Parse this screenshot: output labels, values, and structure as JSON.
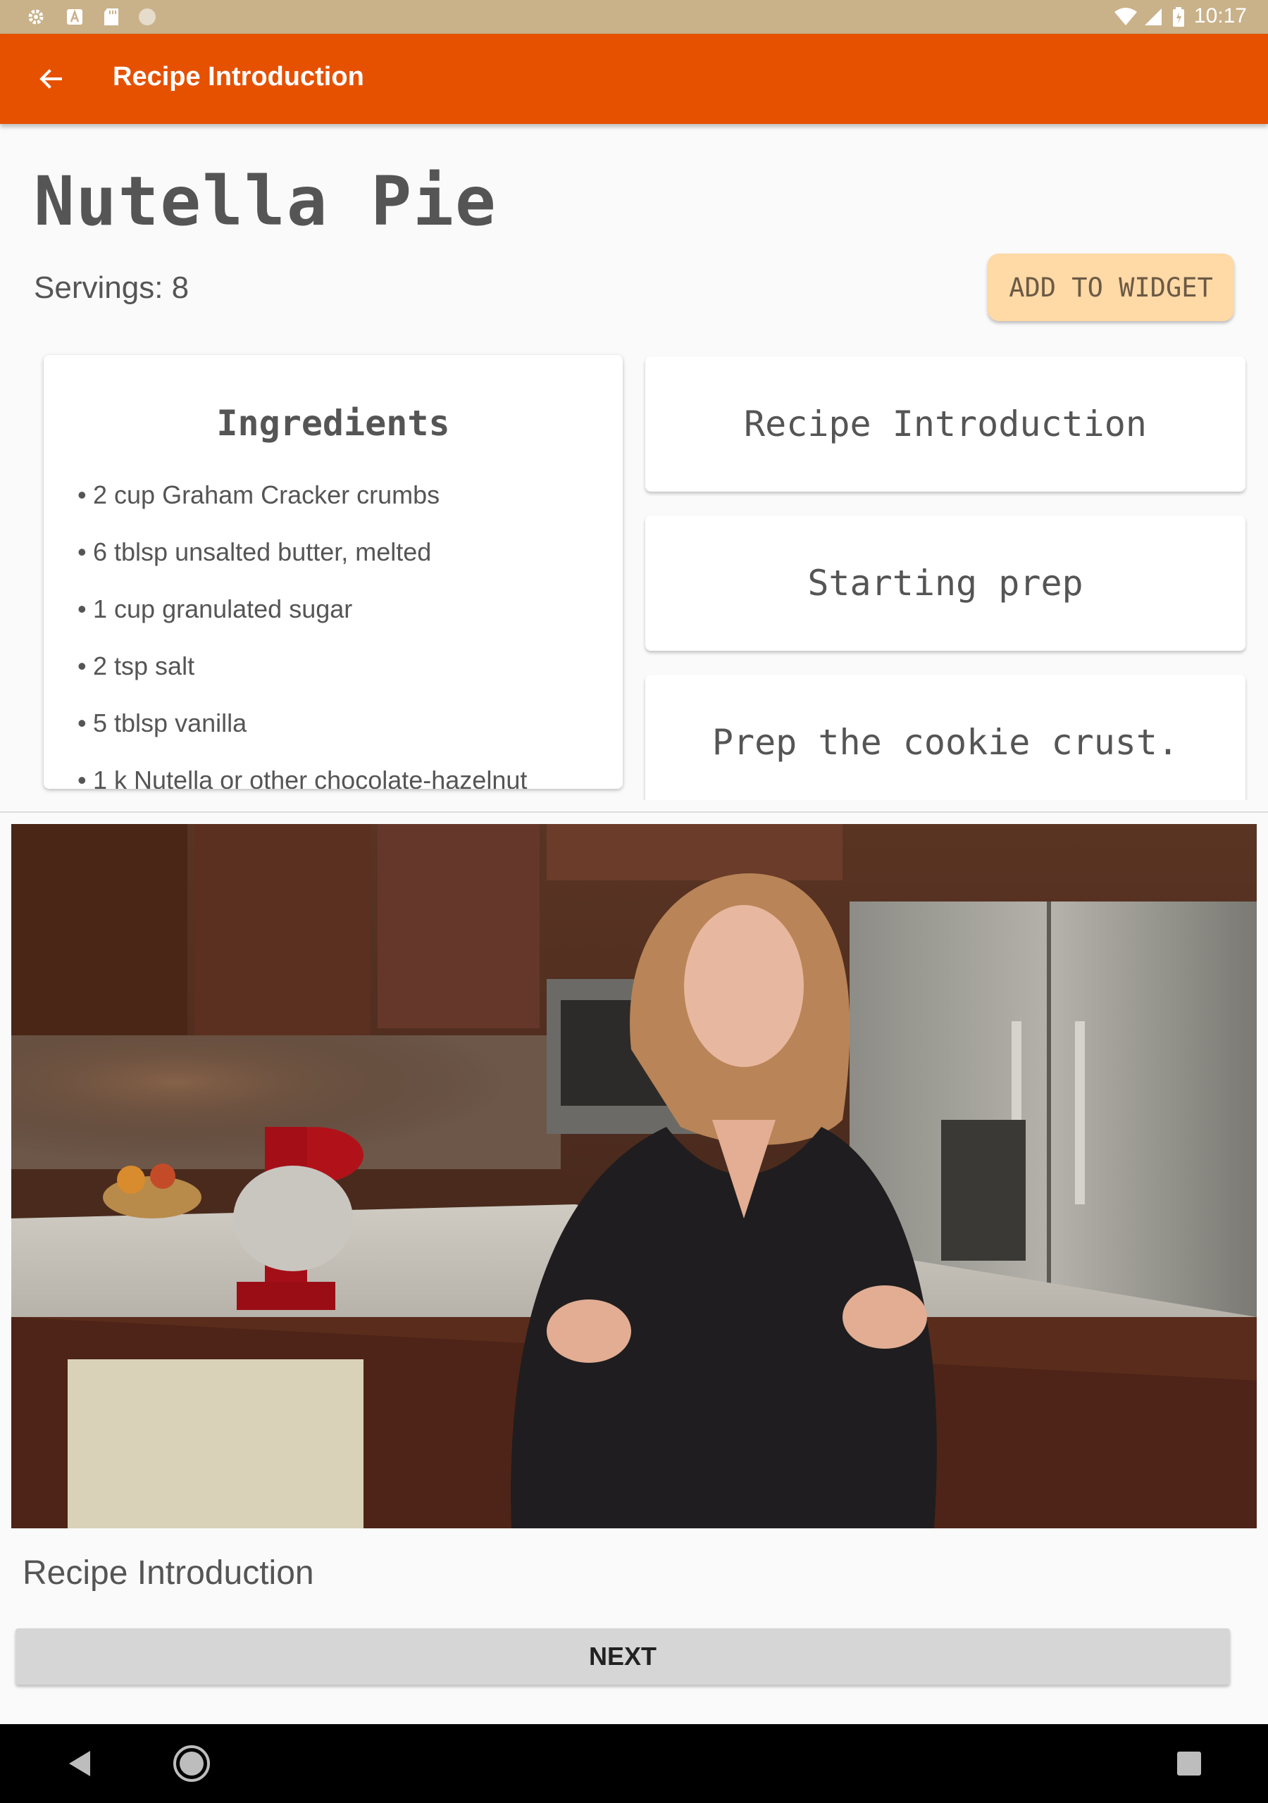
{
  "status_bar": {
    "time": "10:17",
    "left_icons": [
      "settings-icon",
      "a-icon",
      "sd-card-icon",
      "circle-icon"
    ],
    "right_icons": [
      "wifi-icon",
      "signal-icon",
      "battery-icon"
    ]
  },
  "app_bar": {
    "title": "Recipe Introduction",
    "back_icon": "arrow-back-icon",
    "color": "#e65100"
  },
  "recipe": {
    "name": "Nutella Pie",
    "servings": "Servings: 8",
    "add_widget_label": "ADD TO WIDGET"
  },
  "ingredients": {
    "title": "Ingredients",
    "items": [
      "2 cup Graham Cracker crumbs",
      "6 tblsp unsalted butter, melted",
      "1 cup granulated sugar",
      "2 tsp salt",
      "5 tblsp vanilla",
      "1 k Nutella or other chocolate-hazelnut"
    ]
  },
  "steps": [
    "Recipe Introduction",
    "Starting prep",
    "Prep the cookie crust."
  ],
  "player": {
    "caption": "Recipe Introduction",
    "next_label": "NEXT"
  },
  "nav_bar": {
    "icons": [
      "back-triangle-icon",
      "home-circle-icon",
      "recents-square-icon"
    ]
  }
}
